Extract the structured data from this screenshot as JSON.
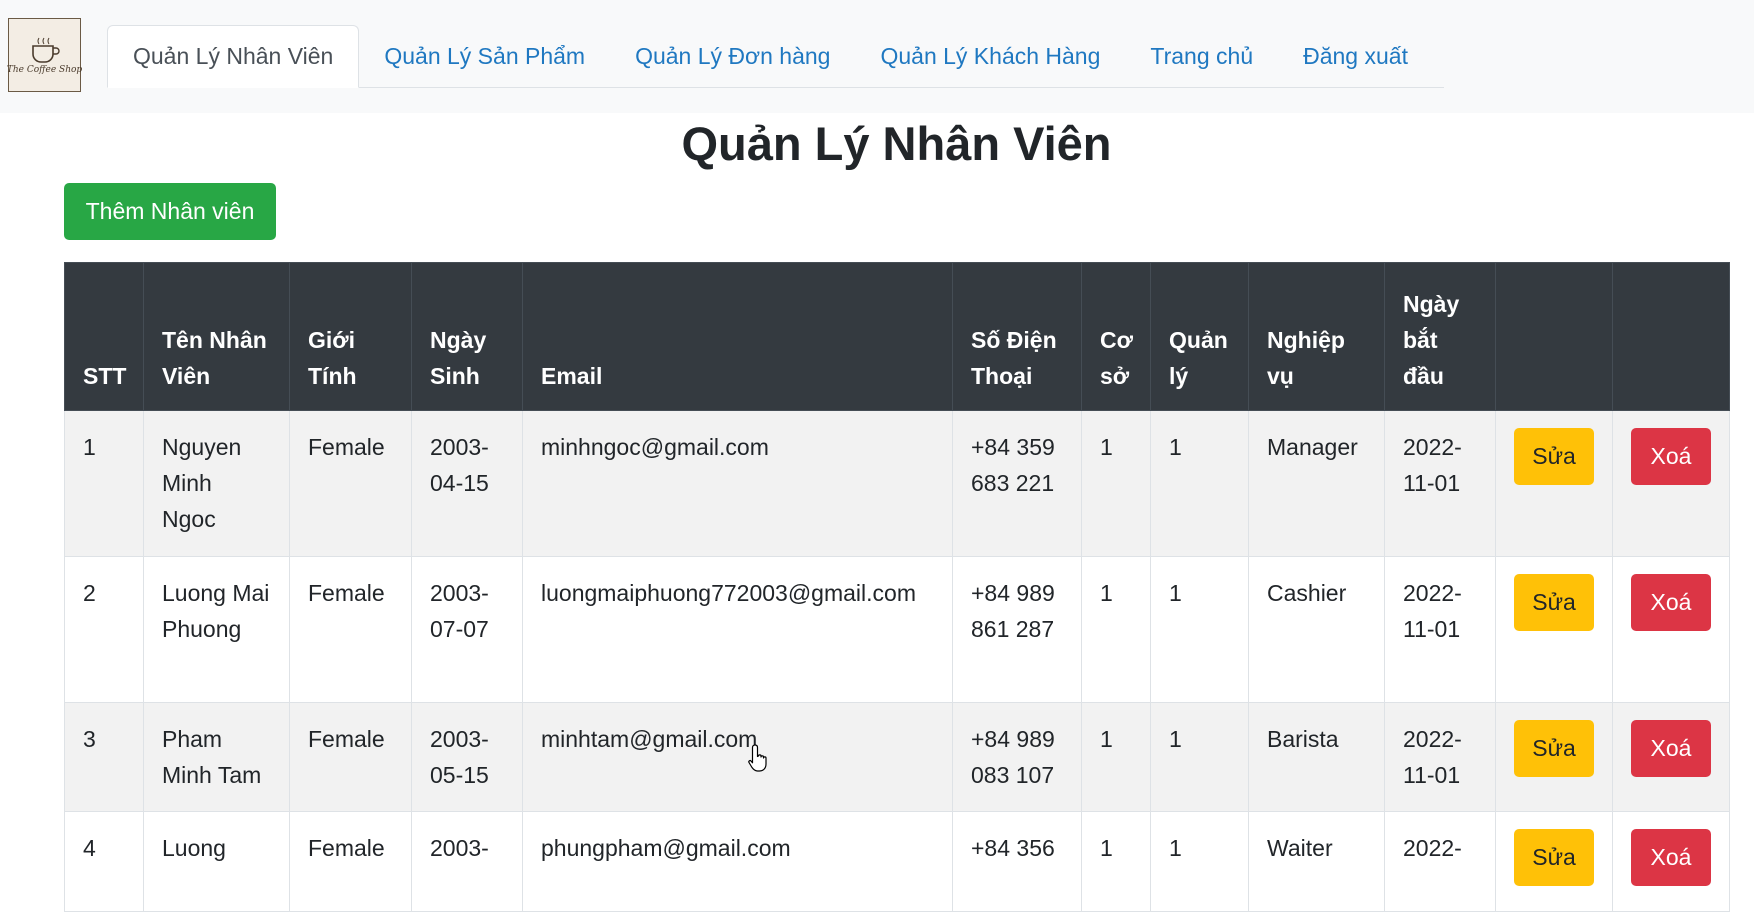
{
  "logo": {
    "text": "The Coffee Shop"
  },
  "nav": {
    "tabs": [
      {
        "label": "Quản Lý Nhân Viên",
        "active": true
      },
      {
        "label": "Quản Lý Sản Phẩm",
        "active": false
      },
      {
        "label": "Quản Lý Đơn hàng",
        "active": false
      },
      {
        "label": "Quản Lý Khách Hàng",
        "active": false
      },
      {
        "label": "Trang chủ",
        "active": false
      },
      {
        "label": "Đăng xuất",
        "active": false
      }
    ]
  },
  "page": {
    "title": "Quản Lý Nhân Viên",
    "add_button": "Thêm Nhân viên"
  },
  "table": {
    "headers": [
      "STT",
      "Tên Nhân Viên",
      "Giới Tính",
      "Ngày Sinh",
      "Email",
      "Số Điện Thoại",
      "Cơ sở",
      "Quản lý",
      "Nghiệp vụ",
      "Ngày bắt đầu",
      "",
      ""
    ],
    "edit_label": "Sửa",
    "delete_label": "Xoá",
    "rows": [
      {
        "stt": "1",
        "name": "Nguyen Minh Ngoc",
        "gender": "Female",
        "dob": "2003-04-15",
        "email": "minhngoc@gmail.com",
        "phone": "+84 359 683 221",
        "branch": "1",
        "manager": "1",
        "role": "Manager",
        "start": "2022-11-01"
      },
      {
        "stt": "2",
        "name": "Luong Mai Phuong",
        "gender": "Female",
        "dob": "2003-07-07",
        "email": "luongmaiphuong772003@gmail.com",
        "phone": "+84 989 861 287",
        "branch": "1",
        "manager": "1",
        "role": "Cashier",
        "start": "2022-11-01"
      },
      {
        "stt": "3",
        "name": "Pham Minh Tam",
        "gender": "Female",
        "dob": "2003-05-15",
        "email": "minhtam@gmail.com",
        "phone": "+84 989 083 107",
        "branch": "1",
        "manager": "1",
        "role": "Barista",
        "start": "2022-11-01"
      },
      {
        "stt": "4",
        "name": "Luong",
        "gender": "Female",
        "dob": "2003-",
        "email": "phungpham@gmail.com",
        "phone": "+84 356",
        "branch": "1",
        "manager": "1",
        "role": "Waiter",
        "start": "2022-"
      }
    ]
  },
  "colors": {
    "nav_link": "#1f78c1",
    "header_bg": "#343a40",
    "add_button": "#28a745",
    "edit_button": "#ffc107",
    "delete_button": "#dc3545"
  }
}
